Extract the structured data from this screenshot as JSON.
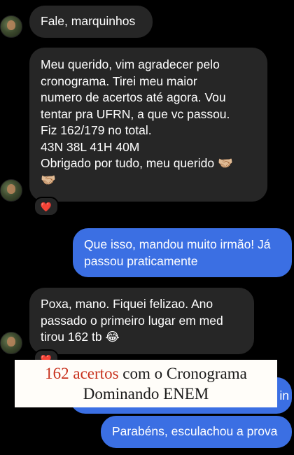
{
  "messages": [
    {
      "text": "Fale, marquinhos"
    },
    {
      "text": "Meu querido, vim agradecer pelo\ncronograma. Tirei meu maior\nnumero de acertos até agora. Vou\ntentar pra UFRN, a que vc passou.\nFiz 162/179 no total.\n43N 38L 41H 40M\nObrigado por tudo, meu querido 🤝🏼\n🤝🏼"
    },
    {
      "text": "Que isso, mandou muito irmão! Já\npassou praticamente"
    },
    {
      "text": "Poxa, mano. Fiquei felizao. Ano\npassado o primeiro lugar em med\ntirou 162 tb 😂"
    },
    {
      "text": "in"
    },
    {
      "text": "Parabéns, esculachou a prova"
    }
  ],
  "reactions": [
    {
      "emoji": "❤️"
    },
    {
      "emoji": "❤️"
    }
  ],
  "caption": {
    "highlight": "162 acertos",
    "line1_rest": " com o Cronograma",
    "line2": "Dominando ENEM"
  },
  "colors": {
    "background": "#000000",
    "received_bubble": "#262626",
    "sent_bubble": "#3b6fe3",
    "caption_highlight": "#c8321e",
    "reaction": "#e0202c"
  }
}
